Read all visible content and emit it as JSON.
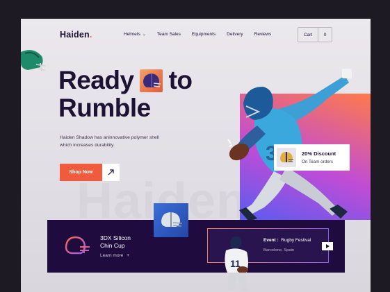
{
  "brand": {
    "name": "Haiden",
    "dot": "."
  },
  "nav": {
    "items": [
      "Helmets",
      "Team Sales",
      "Equipments",
      "Delivery",
      "Reviews"
    ],
    "cart_label": "Cart",
    "cart_count": "0"
  },
  "hero": {
    "title_line1_a": "Ready",
    "title_line1_b": "to",
    "title_line2": "Rumble",
    "tagline": "Haiden Shadow has aninnovative polymer shell which increases durability.",
    "cta_label": "Shop Now",
    "ghost_text": "Haiden"
  },
  "discount": {
    "title": "20% Discount",
    "subtitle": "On Team orders"
  },
  "cup": {
    "title_line1": "3DX Silicon",
    "title_line2": "Chin Cup",
    "learn_more": "Learn more"
  },
  "event": {
    "label": "Event :",
    "name": "Rugby Festival",
    "location": "Barcelone, Spain"
  },
  "colors": {
    "accent": "#f05a3d",
    "dark": "#1c1233",
    "bar": "#1f0b3d",
    "gradient_start": "#ff7a4a",
    "gradient_end": "#5a5cf0"
  }
}
